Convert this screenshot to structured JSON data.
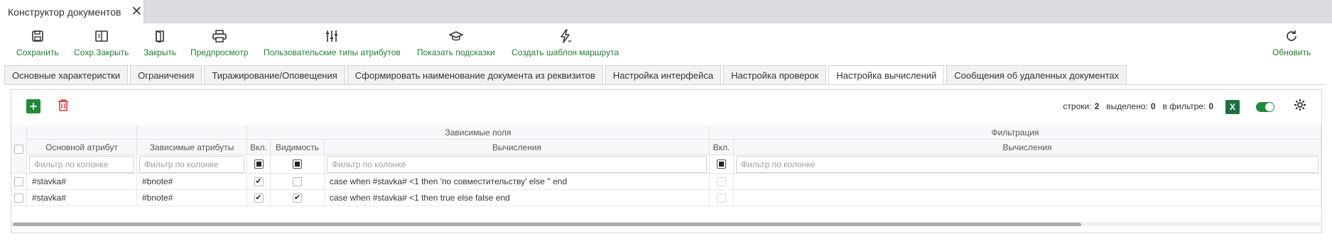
{
  "window": {
    "tab_title": "Конструктор документов"
  },
  "toolbar": {
    "save": "Сохранить",
    "save_close": "Сохр.Закрыть",
    "close": "Закрыть",
    "preview": "Предпросмотр",
    "custom_attr_types": "Пользовательские типы атрибутов",
    "show_hints": "Показать подсказки",
    "create_route_template": "Создать шаблон маршрута",
    "refresh": "Обновить"
  },
  "tabs": [
    {
      "label": "Основные характеристки",
      "active": false
    },
    {
      "label": "Ограничения",
      "active": false
    },
    {
      "label": "Тиражирование/Оповещения",
      "active": false
    },
    {
      "label": "Сформировать наименование документа из реквизитов",
      "active": false
    },
    {
      "label": "Настройка интерфейса",
      "active": false
    },
    {
      "label": "Настройка проверок",
      "active": false
    },
    {
      "label": "Настройка вычислений",
      "active": true
    },
    {
      "label": "Сообщения об удаленных документах",
      "active": false
    }
  ],
  "stats": {
    "rows_label": "строки:",
    "rows_value": "2",
    "selected_label": "выделено:",
    "selected_value": "0",
    "filter_label": "в фильтре:",
    "filter_value": "0"
  },
  "excel_label": "X",
  "grid": {
    "group_dependent": "Зависимые поля",
    "group_filter": "Фильтрация",
    "col_main_attr": "Основной атрибут",
    "col_dep_attrs": "Зависимые атрибуты",
    "col_enabled": "Вкл.",
    "col_visibility": "Видимость",
    "col_calc": "Вычисления",
    "col_f_enabled": "Вкл.",
    "col_f_calc": "Вычисления",
    "filter_placeholder": "Фильтр по колонке",
    "rows": [
      {
        "main_attr": "#stavka#",
        "dep_attrs": "#bnote#",
        "enabled": true,
        "visible": false,
        "calc": "case when #stavka# <1 then 'по совместительству' else '' end",
        "f_enabled": false,
        "f_calc": ""
      },
      {
        "main_attr": "#stavka#",
        "dep_attrs": "#bnote#",
        "enabled": true,
        "visible": true,
        "calc": "case when #stavka# <1 then true else false end",
        "f_enabled": false,
        "f_calc": ""
      }
    ]
  },
  "colors": {
    "accent_green": "#1e8a3c",
    "delete_red": "#d9363e",
    "label_green": "#1e7e34"
  }
}
